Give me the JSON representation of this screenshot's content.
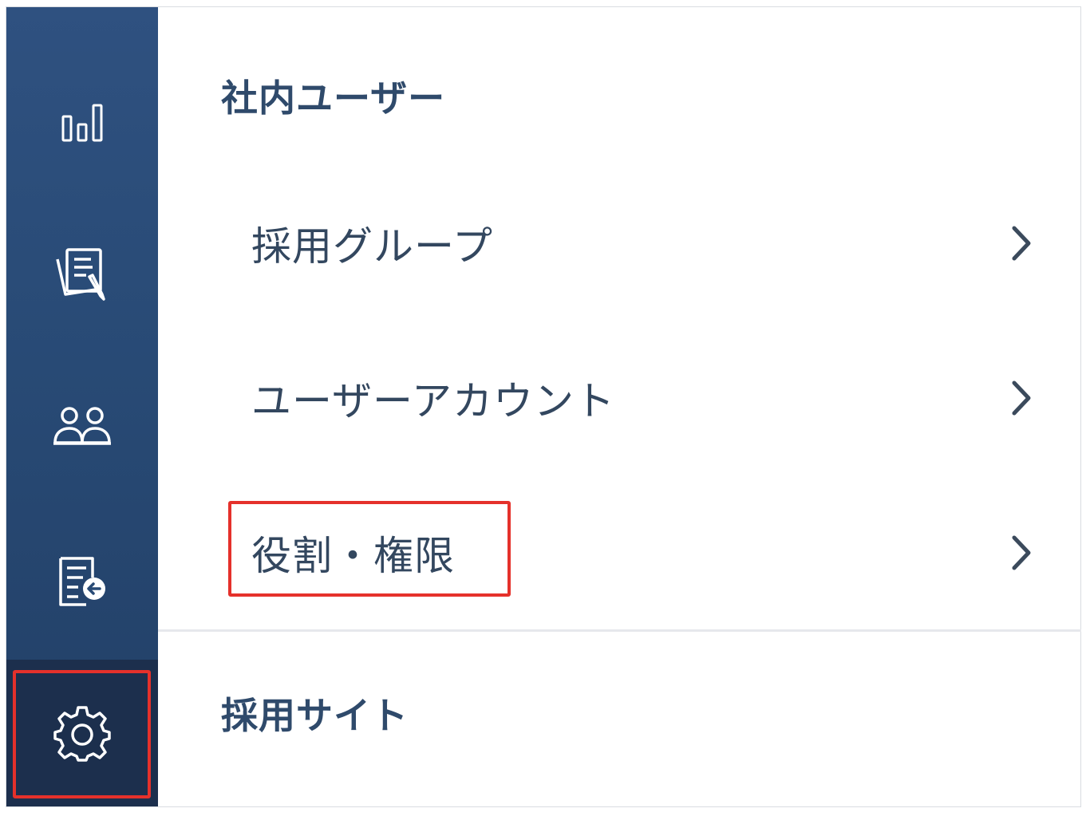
{
  "sidebar": {
    "items": [
      {
        "icon": "bar-chart-icon",
        "label": ""
      },
      {
        "icon": "documents-edit-icon",
        "label": ""
      },
      {
        "icon": "people-icon",
        "label": ""
      },
      {
        "icon": "document-import-icon",
        "label": ""
      },
      {
        "icon": "gear-icon",
        "label": "",
        "active": true
      }
    ]
  },
  "main": {
    "section_internal_users": "社内ユーザー",
    "menu": [
      {
        "label": "採用グループ"
      },
      {
        "label": "ユーザーアカウント"
      },
      {
        "label": "役割・権限",
        "highlighted": true
      }
    ],
    "section_recruit_site": "採用サイト"
  },
  "colors": {
    "sidebar_bg": "#2f5180",
    "sidebar_active_bg": "#1c2f4d",
    "highlight": "#e5312b",
    "title_text": "#2f4a6b",
    "menu_text": "#33475f"
  }
}
